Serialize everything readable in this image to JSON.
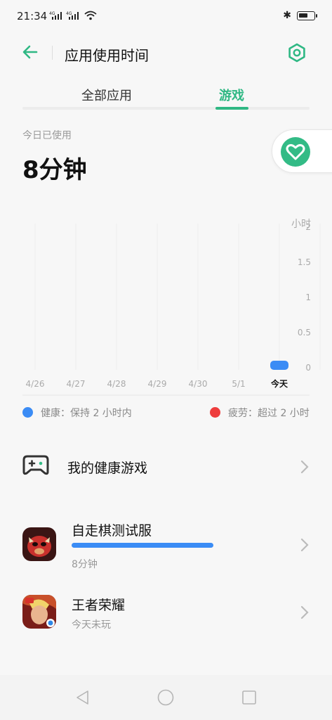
{
  "status_bar": {
    "time": "21:34",
    "network_1": "4G",
    "network_2": "4G"
  },
  "header": {
    "title": "应用使用时间"
  },
  "tabs": [
    {
      "label": "全部应用",
      "active": false
    },
    {
      "label": "游戏",
      "active": true
    }
  ],
  "usage": {
    "label": "今日已使用",
    "value": "8分钟"
  },
  "chart_data": {
    "type": "bar",
    "categories": [
      "4/26",
      "4/27",
      "4/28",
      "4/29",
      "4/30",
      "5/1",
      "今天"
    ],
    "values": [
      0,
      0,
      0,
      0,
      0,
      0,
      0.13
    ],
    "ylabel": "小时",
    "ylim": [
      0,
      2
    ],
    "yticks": [
      "2",
      "1.5",
      "1",
      "0.5",
      "0"
    ],
    "grid": "vertical"
  },
  "legend": [
    {
      "label": "健康：保持 2 小时内",
      "color": "#3b8cf5"
    },
    {
      "label": "疲劳：超过 2 小时",
      "color": "#ee3d3d"
    }
  ],
  "healthy_games": {
    "label": "我的健康游戏",
    "icon": "gamepad-icon"
  },
  "apps": [
    {
      "name": "自走棋测试服",
      "usage": "8分钟",
      "progress": 0.48,
      "bar_color": "#3b8cf5"
    },
    {
      "name": "王者荣耀",
      "usage": "今天未玩"
    }
  ],
  "colors": {
    "accent": "#2fb884",
    "healthy": "#3b8cf5",
    "fatigue": "#ee3d3d"
  }
}
